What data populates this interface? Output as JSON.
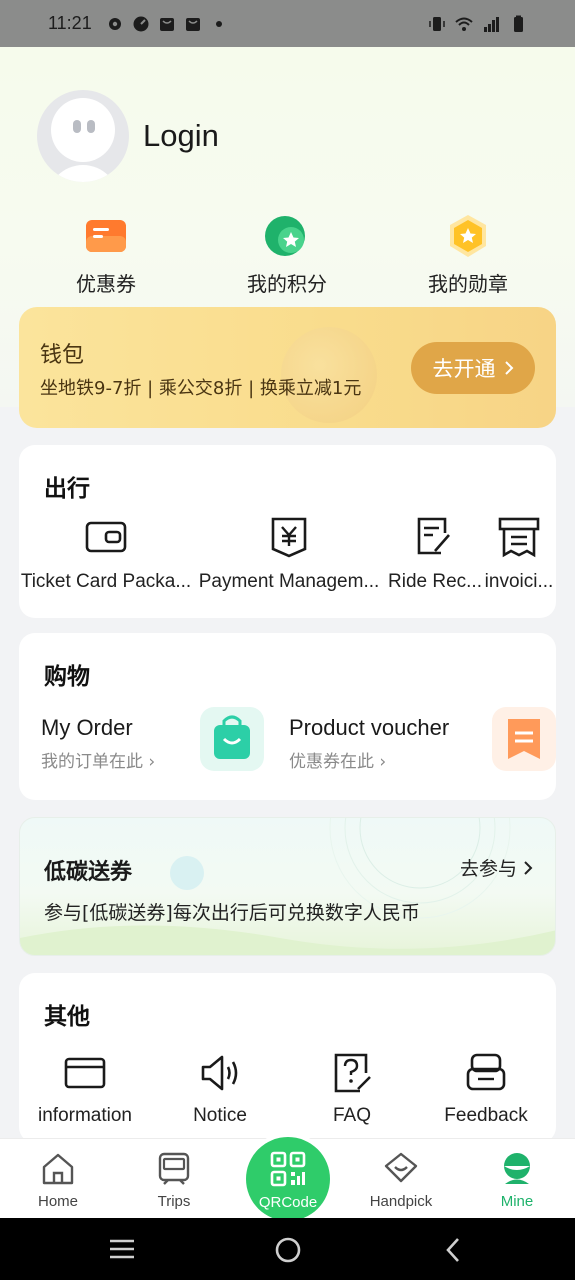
{
  "status_bar": {
    "time": "11:21"
  },
  "profile": {
    "login_label": "Login"
  },
  "quick_links": [
    {
      "label": "优惠券",
      "icon": "coupon-icon"
    },
    {
      "label": "我的积分",
      "icon": "points-icon"
    },
    {
      "label": "我的勋章",
      "icon": "medal-icon"
    }
  ],
  "wallet": {
    "title": "钱包",
    "subtitle": "坐地铁9-7折 | 乘公交8折 | 换乘立减1元",
    "button_label": "去开通"
  },
  "travel": {
    "title": "出行",
    "items": [
      {
        "label": "Ticket Card Packa...",
        "icon": "wallet-card-icon"
      },
      {
        "label": "Payment Managem...",
        "icon": "yuan-shield-icon"
      },
      {
        "label": "Ride Rec...",
        "icon": "edit-record-icon"
      },
      {
        "label": "invoici...",
        "icon": "invoice-icon"
      }
    ]
  },
  "shopping": {
    "title": "购物",
    "order": {
      "title": "My Order",
      "subtitle": "我的订单在此"
    },
    "voucher": {
      "title": "Product voucher",
      "subtitle": "优惠券在此"
    }
  },
  "low_carbon": {
    "title": "低碳送券",
    "subtitle": "参与[低碳送券]每次出行后可兑换数字人民币",
    "link": "去参与"
  },
  "other": {
    "title": "其他",
    "items": [
      {
        "label": "information",
        "icon": "envelope-icon"
      },
      {
        "label": "Notice",
        "icon": "speaker-icon"
      },
      {
        "label": "FAQ",
        "icon": "question-doc-icon"
      },
      {
        "label": "Feedback",
        "icon": "feedback-icon"
      }
    ]
  },
  "bottom_nav": [
    {
      "label": "Home",
      "icon": "home-icon"
    },
    {
      "label": "Trips",
      "icon": "train-icon"
    },
    {
      "label": "QRCode",
      "icon": "qr-code-icon"
    },
    {
      "label": "Handpick",
      "icon": "handpick-icon"
    },
    {
      "label": "Mine",
      "icon": "mine-icon",
      "active": true
    }
  ],
  "colors": {
    "accent_green": "#2fcc6a",
    "wallet_button": "#e0a648"
  }
}
